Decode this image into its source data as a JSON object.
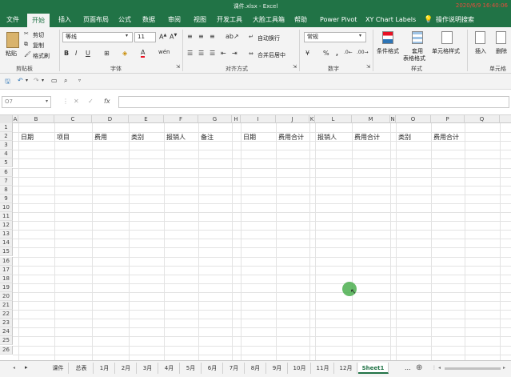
{
  "window": {
    "title": "课件.xlsx - Excel",
    "timestamp": "2020/6/9 16:40:06"
  },
  "ribbon_tabs": [
    "文件",
    "开始",
    "插入",
    "页面布局",
    "公式",
    "数据",
    "审阅",
    "视图",
    "开发工具",
    "大脸工具箱",
    "帮助",
    "Power Pivot",
    "XY Chart Labels",
    "操作说明搜索"
  ],
  "active_tab": "开始",
  "ribbon": {
    "paste": "粘贴",
    "cut": "剪切",
    "copy": "复制",
    "format_painter": "格式刷",
    "clipboard_label": "剪贴板",
    "font_name": "等线",
    "font_size": "11",
    "font_label": "字体",
    "wrap_text": "自动换行",
    "merge_center": "合并后居中",
    "align_label": "对齐方式",
    "number_format": "常规",
    "number_label": "数字",
    "conditional_format": "条件格式",
    "format_table_1": "套用",
    "format_table_2": "表格格式",
    "cell_styles": "单元格样式",
    "styles_label": "样式",
    "insert": "插入",
    "delete": "删除",
    "cells_label": "单元格"
  },
  "formula_bar": {
    "name_box": "O7",
    "fx": "fx"
  },
  "columns": [
    "A",
    "B",
    "C",
    "D",
    "E",
    "F",
    "G",
    "H",
    "I",
    "J",
    "K",
    "L",
    "M",
    "N",
    "O",
    "P",
    "Q"
  ],
  "row_numbers": [
    "1",
    "2",
    "3",
    "4",
    "5",
    "6",
    "7",
    "8",
    "9",
    "10",
    "11",
    "12",
    "13",
    "14",
    "15",
    "16",
    "17",
    "18",
    "19",
    "20",
    "21",
    "22",
    "23",
    "24",
    "25",
    "26"
  ],
  "row2_cells": [
    {
      "col": "B",
      "text": "日期"
    },
    {
      "col": "C",
      "text": "项目"
    },
    {
      "col": "D",
      "text": "费用"
    },
    {
      "col": "E",
      "text": "类别"
    },
    {
      "col": "F",
      "text": "报销人"
    },
    {
      "col": "G",
      "text": "备注"
    },
    {
      "col": "I",
      "text": "日期"
    },
    {
      "col": "J",
      "text": "费用合计"
    },
    {
      "col": "L",
      "text": "报销人"
    },
    {
      "col": "M",
      "text": "费用合计"
    },
    {
      "col": "O",
      "text": "类别"
    },
    {
      "col": "P",
      "text": "费用合计"
    }
  ],
  "sheet_tabs": [
    "课件",
    "总表",
    "1月",
    "2月",
    "3月",
    "4月",
    "5月",
    "6月",
    "7月",
    "8月",
    "9月",
    "10月",
    "11月",
    "12月",
    "Sheet1"
  ],
  "active_sheet": "Sheet1",
  "sheet_more": "...",
  "sheet_add": "⊕",
  "sheet_nav": "▸"
}
